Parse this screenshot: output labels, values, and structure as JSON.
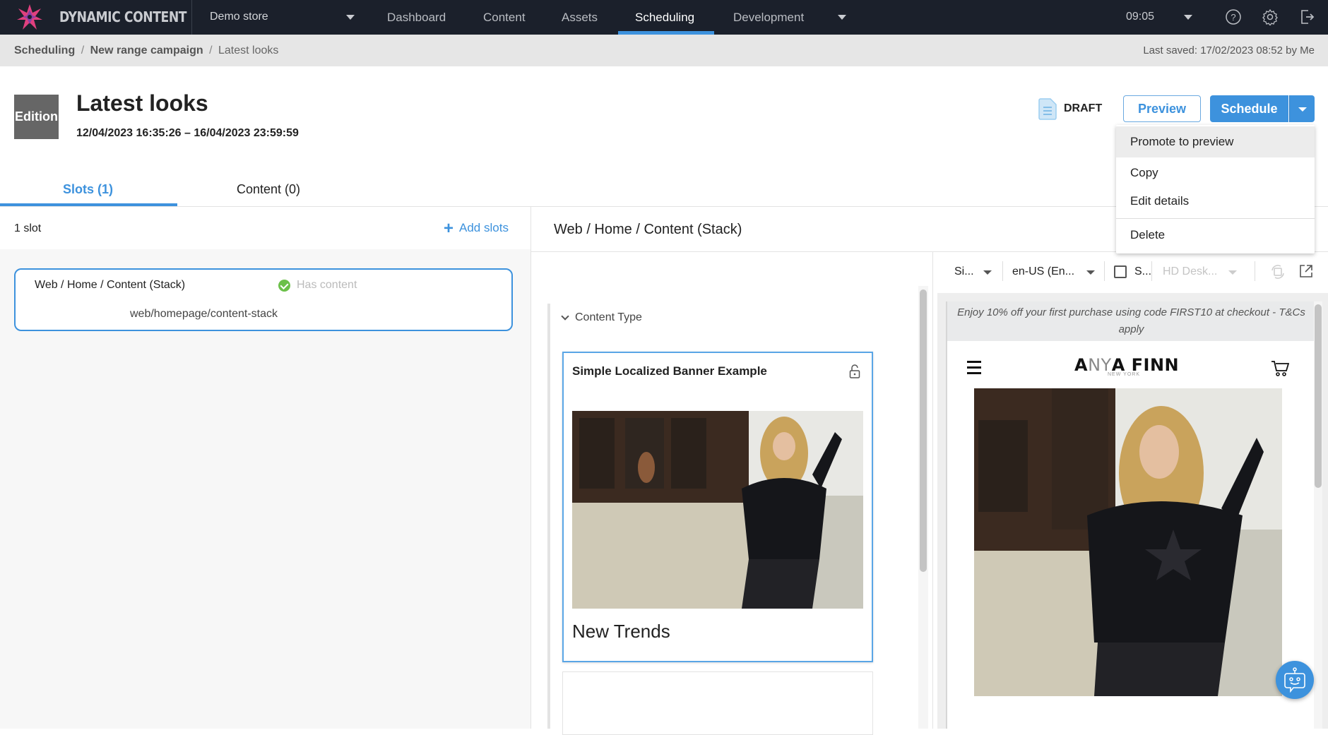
{
  "topnav": {
    "brand": "DYNAMIC CONTENT",
    "store": "Demo store",
    "links": [
      "Dashboard",
      "Content",
      "Assets",
      "Scheduling",
      "Development"
    ],
    "active_link": "Scheduling",
    "time": "09:05",
    "icons": [
      "help-icon",
      "settings-icon",
      "logout-icon"
    ]
  },
  "breadcrumb": {
    "items": [
      "Scheduling",
      "New range campaign",
      "Latest looks"
    ],
    "separator": "/",
    "last_saved": "Last saved: 17/02/2023 08:52 by Me"
  },
  "edition": {
    "badge": "Edition",
    "title": "Latest looks",
    "dates": "12/04/2023 16:35:26  –  16/04/2023 23:59:59",
    "status": "DRAFT",
    "preview_label": "Preview",
    "schedule_label": "Schedule"
  },
  "schedule_menu": {
    "items": [
      "Promote to preview",
      "Copy",
      "Edit details",
      "Delete"
    ],
    "highlighted": "Promote to preview"
  },
  "tabs": [
    {
      "label": "Slots (1)",
      "active": true
    },
    {
      "label": "Content (0)",
      "active": false
    }
  ],
  "slots_panel": {
    "count_label": "1 slot",
    "add_label": "Add slots",
    "slots": [
      {
        "name": "Web / Home / Content (Stack)",
        "status": "Has content",
        "key": "web/homepage/content-stack"
      }
    ]
  },
  "slot_editor": {
    "title": "Web / Home / Content (Stack)",
    "section_label": "Content Type",
    "card": {
      "title": "Simple Localized Banner Example",
      "caption": "New Trends"
    }
  },
  "preview_panel": {
    "toolbar": {
      "visualization": "Si...",
      "locale": "en-US (En...",
      "checkbox_label": "S...",
      "checkbox_checked": false,
      "device": "HD Desk..."
    },
    "promo_text": "Enjoy 10% off your first purchase using code FIRST10 at checkout - T&Cs apply",
    "logo_parts": [
      "A",
      "NY",
      "A FINN"
    ],
    "logo_sub": "NEW YORK"
  },
  "colors": {
    "accent": "#3d92dd",
    "nav_bg": "#1b202b",
    "success": "#6cc04a"
  }
}
